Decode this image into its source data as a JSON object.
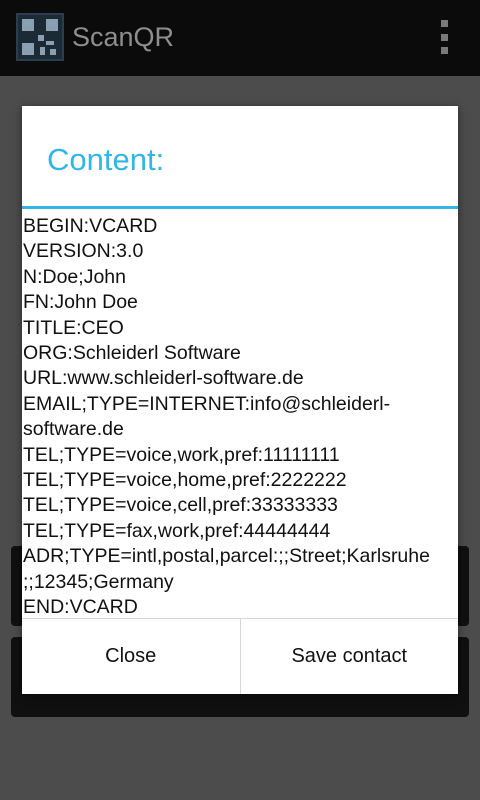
{
  "action_bar": {
    "title": "ScanQR",
    "app_icon": "qr-code-icon",
    "menu_icon": "overflow-menu-icon"
  },
  "dialog": {
    "title": "Content:",
    "content_lines": [
      "BEGIN:VCARD",
      "VERSION:3.0",
      "N:Doe;John",
      "FN:John Doe",
      "TITLE:CEO",
      "ORG:Schleiderl Software",
      "URL:www.schleiderl-software.de",
      "EMAIL;TYPE=INTERNET:info@schleiderl-",
      "software.de",
      "TEL;TYPE=voice,work,pref:11111111",
      "TEL;TYPE=voice,home,pref:2222222",
      "TEL;TYPE=voice,cell,pref:33333333",
      "TEL;TYPE=fax,work,pref:44444444",
      "ADR;TYPE=intl,postal,parcel:;;Street;Karlsruhe",
      ";;12345;Germany",
      "END:VCARD"
    ],
    "buttons": {
      "close": "Close",
      "save_contact": "Save contact"
    }
  },
  "colors": {
    "accent": "#33b5e5",
    "scrim": "#4c4c4c",
    "action_bar": "#0b0b0b"
  }
}
